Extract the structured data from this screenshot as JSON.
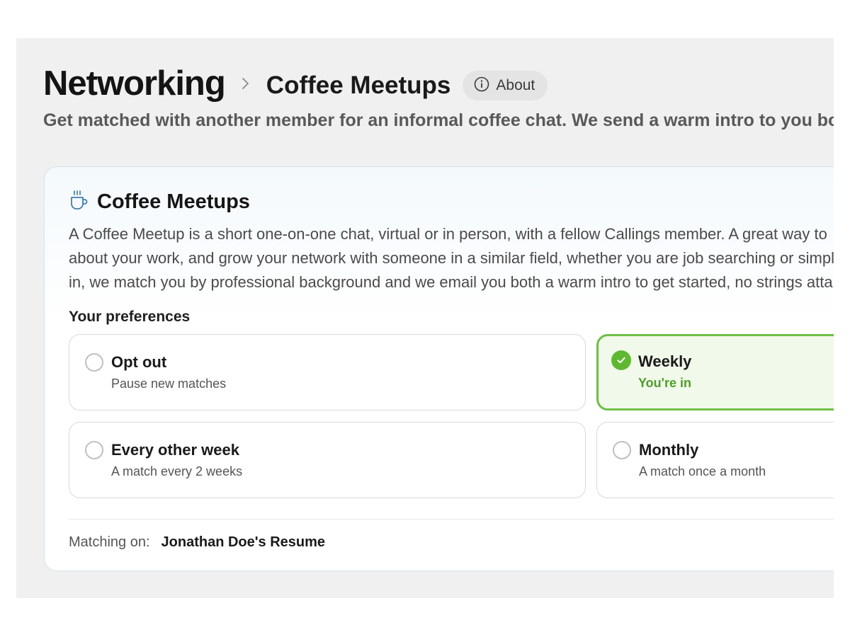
{
  "breadcrumb": {
    "root": "Networking",
    "current": "Coffee Meetups"
  },
  "about_button": {
    "label": "About",
    "icon": "info-icon"
  },
  "subtitle": "Get matched with another member for an informal coffee chat. We send a warm intro to you both;",
  "card": {
    "icon": "coffee-cup-icon",
    "title": "Coffee Meetups",
    "description_lines": [
      "A Coffee Meetup is a short one-on-one chat, virtual or in person, with a fellow Callings member. A great way to",
      "about your work, and grow your network with someone in a similar field, whether you are job searching or simpl",
      "in, we match you by professional background and we email you both a warm intro to get started, no strings atta"
    ],
    "preferences_label": "Your preferences",
    "options": [
      {
        "title": "Opt out",
        "subtitle": "Pause new matches",
        "selected": false
      },
      {
        "title": "Weekly",
        "subtitle": "You're in",
        "selected": true
      },
      {
        "title": "Every other week",
        "subtitle": "A match every 2 weeks",
        "selected": false
      },
      {
        "title": "Monthly",
        "subtitle": "A match once a month",
        "selected": false
      }
    ],
    "matching_label": "Matching on:",
    "matching_value": "Jonathan Doe's Resume"
  },
  "colors": {
    "selected_accent": "#5fb832",
    "icon_blue": "#3f7fa8"
  }
}
